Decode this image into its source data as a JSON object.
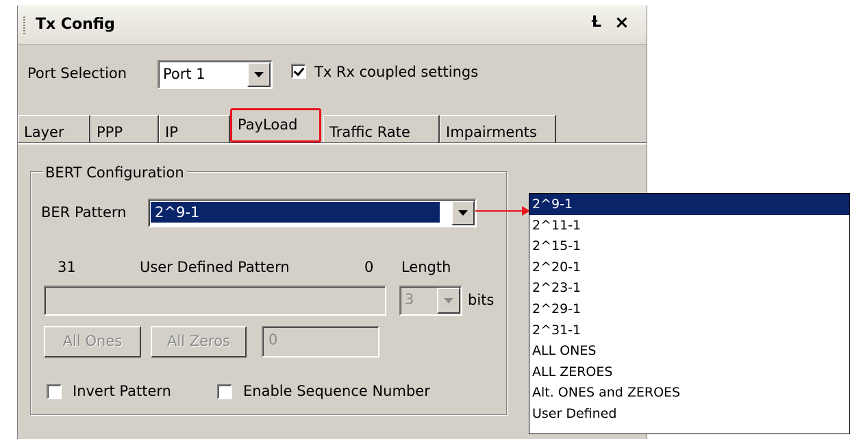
{
  "window": {
    "title": "Tx Config",
    "pin_glyph": "Ɫ",
    "close_glyph": "×"
  },
  "port": {
    "label": "Port Selection",
    "value": "Port 1",
    "coupled_label": "Tx Rx coupled settings",
    "coupled_checked": true
  },
  "tabs": [
    {
      "label": "Layer"
    },
    {
      "label": "PPP"
    },
    {
      "label": "IP"
    },
    {
      "label": "PayLoad",
      "active": true
    },
    {
      "label": "Traffic Rate"
    },
    {
      "label": "Impairments"
    }
  ],
  "bert": {
    "group_label": "BERT Configuration",
    "ber_label": "BER Pattern",
    "ber_value": "2^9-1",
    "left_bit": "31",
    "user_pattern_label": "User Defined Pattern",
    "right_bit": "0",
    "length_label": "Length",
    "pattern_value": "",
    "length_value": "3",
    "bits_label": "bits",
    "all_ones_label": "All Ones",
    "all_zeros_label": "All Zeros",
    "fill_value": "0",
    "invert_label": "Invert Pattern",
    "invert_checked": false,
    "sequence_label": "Enable Sequence Number",
    "sequence_checked": false
  },
  "dropdown": {
    "options": [
      "2^9-1",
      "2^11-1",
      "2^15-1",
      "2^20-1",
      "2^23-1",
      "2^29-1",
      "2^31-1",
      "ALL ONES",
      "ALL ZEROES",
      "Alt. ONES and ZEROES",
      "User Defined"
    ],
    "selected_index": 0
  },
  "colors": {
    "highlight": "#e8141e",
    "selection": "#0a246a",
    "face": "#d4d0c8"
  }
}
